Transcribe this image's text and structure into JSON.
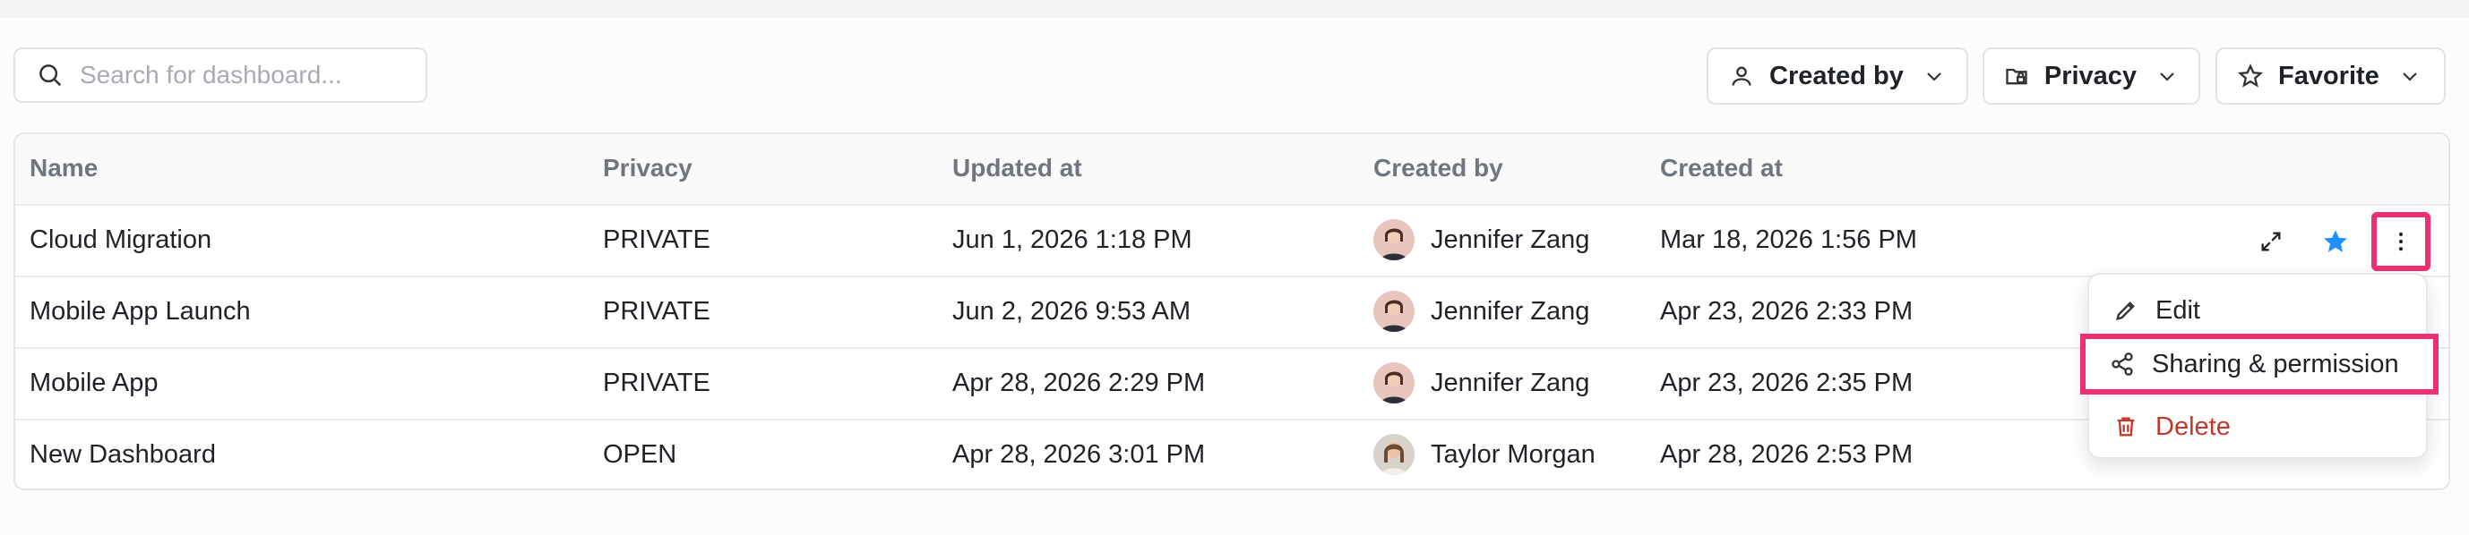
{
  "search": {
    "placeholder": "Search for dashboard..."
  },
  "filters": [
    {
      "label": "Created by",
      "icon": "user-icon"
    },
    {
      "label": "Privacy",
      "icon": "folder-lock-icon"
    },
    {
      "label": "Favorite",
      "icon": "star-outline-icon"
    }
  ],
  "table": {
    "columns": [
      "Name",
      "Privacy",
      "Updated at",
      "Created by",
      "Created at"
    ],
    "rows": [
      {
        "name": "Cloud Migration",
        "privacy": "PRIVATE",
        "updated": "Jun 1, 2026 1:18 PM",
        "creator": "Jennifer Zang",
        "created": "Mar 18, 2026 1:56 PM"
      },
      {
        "name": "Mobile App Launch",
        "privacy": "PRIVATE",
        "updated": "Jun 2, 2026 9:53 AM",
        "creator": "Jennifer Zang",
        "created": "Apr 23, 2026 2:33 PM"
      },
      {
        "name": "Mobile App",
        "privacy": "PRIVATE",
        "updated": "Apr 28, 2026 2:29 PM",
        "creator": "Jennifer Zang",
        "created": "Apr 23, 2026 2:35 PM"
      },
      {
        "name": "New Dashboard",
        "privacy": "OPEN",
        "updated": "Apr 28, 2026 3:01 PM",
        "creator": "Taylor Morgan",
        "created": "Apr 28, 2026 2:53 PM"
      }
    ]
  },
  "row_actions": {
    "expand_icon": "expand-icon",
    "favorite_icon": "star-filled-icon",
    "more_icon": "more-vertical-icon"
  },
  "menu": {
    "items": [
      {
        "label": "Edit",
        "icon": "pencil-icon"
      },
      {
        "label": "Sharing & permission",
        "icon": "share-icon"
      },
      {
        "label": "Delete",
        "icon": "trash-icon"
      }
    ]
  },
  "colors": {
    "highlight": "#f0306e",
    "favorite": "#1e90ff",
    "danger": "#c0392b"
  }
}
